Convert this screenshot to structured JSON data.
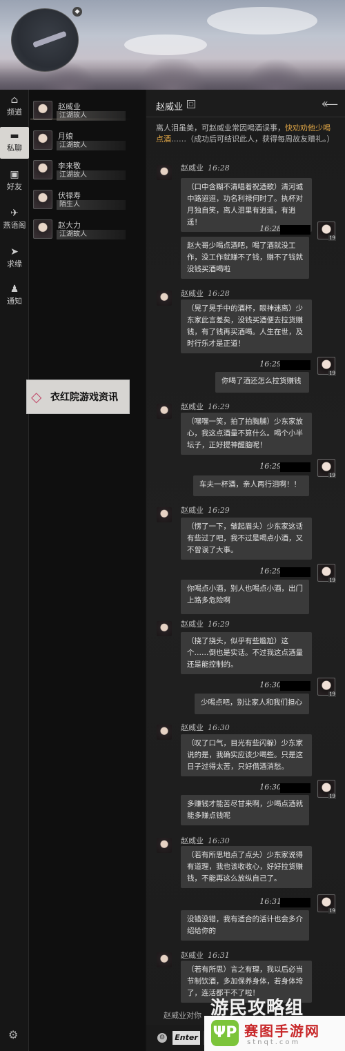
{
  "left_nav": [
    {
      "icon": "home-icon",
      "label": "频道"
    },
    {
      "icon": "chat-icon",
      "label": "私聊"
    },
    {
      "icon": "friend-icon",
      "label": "好友"
    },
    {
      "icon": "swallow-icon",
      "label": "燕语阁"
    },
    {
      "icon": "send-icon",
      "label": "求缘"
    },
    {
      "icon": "bell-icon",
      "label": "通知"
    }
  ],
  "contacts": [
    {
      "name": "赵威业",
      "tag": "江湖故人"
    },
    {
      "name": "月娘",
      "tag": "江湖故人"
    },
    {
      "name": "李来敬",
      "tag": "江湖故人"
    },
    {
      "name": "伏禄寿",
      "tag": "陌生人"
    },
    {
      "name": "赵大力",
      "tag": "江湖故人"
    }
  ],
  "watermark_left": "衣红院游戏资讯",
  "chat": {
    "title": "赵威业",
    "intro_plain": "离人泪虽美，可赵威业常因喝酒误事，",
    "intro_highlight": "快劝劝他少喝点酒",
    "intro_tail": "……（成功后可结识此人，获得每周故友赠礼。）",
    "npc_name": "赵威业",
    "messages": [
      {
        "side": "npc",
        "time": "16:28",
        "text": "（口中含糊不清唱着祝酒歌）清河城中路迢迢，功名利禄何时了。执杯对月独自笑，离人泪里有逍遥，有逍遥！"
      },
      {
        "side": "me",
        "time": "16:28",
        "text": "赵大哥少喝点酒吧，喝了酒就没工作，没工作就赚不了钱，赚不了钱就没钱买酒喝啦"
      },
      {
        "side": "npc",
        "time": "16:28",
        "text": "（晃了晃手中的酒杯，眼神迷离）少东家此言差矣，没钱买酒便去拉货赚钱，有了钱再买酒喝。人生在世，及时行乐才是正道！"
      },
      {
        "side": "me",
        "time": "16:29",
        "text": "你喝了酒还怎么拉货赚钱"
      },
      {
        "side": "npc",
        "time": "16:29",
        "text": "（嘿嘿一笑，拍了拍胸脯）少东家放心，我这点酒量不算什么。喝个小半坛子，正好提神醒脑呢！"
      },
      {
        "side": "me",
        "time": "16:29",
        "text": "车夫一杯酒，亲人两行泪啊！！"
      },
      {
        "side": "npc",
        "time": "16:29",
        "text": "（愣了一下，皱起眉头）少东家这话有些过了吧，我不过是喝点小酒，又不曾误了大事。"
      },
      {
        "side": "me",
        "time": "16:29",
        "text": "你喝点小酒，别人也喝点小酒，出门上路多危险啊"
      },
      {
        "side": "npc",
        "time": "16:29",
        "text": "（挠了挠头，似乎有些尴尬）这个……倒也是实话。不过我这点酒量还是能控制的。"
      },
      {
        "side": "me",
        "time": "16:30",
        "text": "少喝点吧，别让家人和我们担心"
      },
      {
        "side": "npc",
        "time": "16:30",
        "text": "（叹了口气，目光有些闪躲）少东家说的是，我确实应该少喝些。只是这日子过得太苦，只好借酒消愁。"
      },
      {
        "side": "me",
        "time": "16:30",
        "text": "多赚钱才能苦尽甘来啊，少喝点酒就能多赚点钱呢"
      },
      {
        "side": "npc",
        "time": "16:30",
        "text": "（若有所思地点了点头）少东家说得有道理，我也该收收心，好好拉货赚钱，不能再这么放纵自己了。"
      },
      {
        "side": "me",
        "time": "16:31",
        "text": "没错没错，我有适合的活计也会多介绍给你的"
      },
      {
        "side": "npc",
        "time": "16:31",
        "text": "（若有所思）言之有理，我以后必当节制饮酒，多加保养身体，若身体垮了，连活都干不了啦！"
      }
    ],
    "my_level": "19",
    "bottom_note": "赵威业对你",
    "enter_label": "Enter",
    "input_value": ""
  },
  "watermark_brand": "游民攻略组",
  "watermark_site": "赛图手游网",
  "watermark_url": "stnqt.com",
  "watermark_logo": "ΨP"
}
